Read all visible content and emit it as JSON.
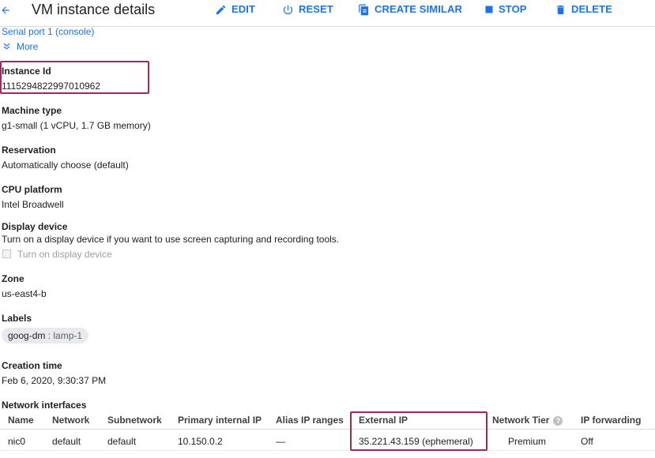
{
  "header": {
    "back_icon": "arrow-back-icon",
    "title": "VM instance details",
    "actions": {
      "edit": "EDIT",
      "reset": "RESET",
      "create_similar": "CREATE SIMILAR",
      "stop": "STOP",
      "delete": "DELETE"
    }
  },
  "links": {
    "serial_port": "Serial port 1 (console)",
    "more": "More"
  },
  "fields": {
    "instance_id": {
      "title": "Instance Id",
      "value": "1115294822997010962"
    },
    "machine_type": {
      "title": "Machine type",
      "value": "g1-small (1 vCPU, 1.7 GB memory)"
    },
    "reservation": {
      "title": "Reservation",
      "value": "Automatically choose (default)"
    },
    "cpu_platform": {
      "title": "CPU platform",
      "value": "Intel Broadwell"
    },
    "display_device": {
      "title": "Display device",
      "description": "Turn on a display device if you want to use screen capturing and recording tools.",
      "checkbox_label": "Turn on display device",
      "checked": false
    },
    "zone": {
      "title": "Zone",
      "value": "us-east4-b"
    },
    "labels": {
      "title": "Labels",
      "chip_key": "goog-dm",
      "chip_separator": " : ",
      "chip_value": "lamp-1"
    },
    "creation_time": {
      "title": "Creation time",
      "value": "Feb 6, 2020, 9:30:37 PM"
    }
  },
  "network": {
    "title": "Network interfaces",
    "columns": [
      "Name",
      "Network",
      "Subnetwork",
      "Primary internal IP",
      "Alias IP ranges",
      "External IP",
      "Network Tier",
      "IP forwarding"
    ],
    "rows": [
      [
        "nic0",
        "default",
        "default",
        "10.150.0.2",
        "—",
        "35.221.43.159 (ephemeral)",
        "Premium",
        "Off"
      ]
    ]
  },
  "colors": {
    "accent": "#1a73e8",
    "highlight": "#a0285f",
    "text": "#202124"
  }
}
